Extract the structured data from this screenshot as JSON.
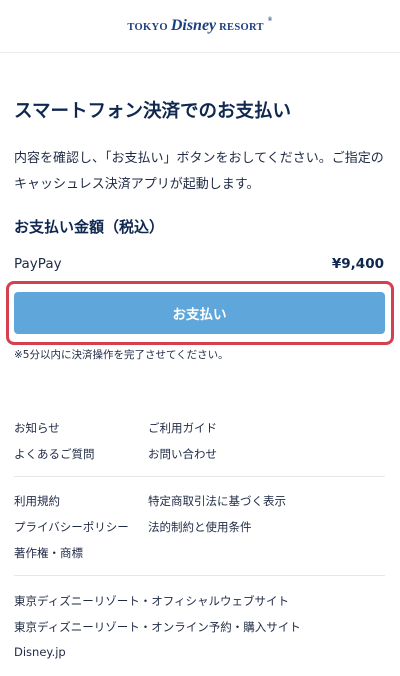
{
  "header": {
    "logo": {
      "part1": "TOKYO",
      "part2": "Disney",
      "part3": "RESORT",
      "reg": "®"
    }
  },
  "main": {
    "title": "スマートフォン決済でのお支払い",
    "description": "内容を確認し、「お支払い」ボタンをおしてください。ご指定のキャッシュレス決済アプリが起動します。",
    "amount_heading": "お支払い金額（税込）",
    "payment_method": "PayPay",
    "amount": "¥9,400",
    "pay_button_label": "お支払い",
    "note": "※5分以内に決済操作を完了させてください。"
  },
  "footer": {
    "group1": {
      "left": [
        "お知らせ",
        "よくあるご質問"
      ],
      "right": [
        "ご利用ガイド",
        "お問い合わせ"
      ]
    },
    "group2": {
      "left": [
        "利用規約",
        "プライバシーポリシー",
        "著作権・商標"
      ],
      "right": [
        "特定商取引法に基づく表示",
        "法的制約と使用条件"
      ]
    },
    "group3": [
      "東京ディズニーリゾート・オフィシャルウェブサイト",
      "東京ディズニーリゾート・オンライン予約・購入サイト",
      "Disney.jp"
    ]
  },
  "colors": {
    "accent_button": "#5fa7db",
    "highlight_border": "#d5404f",
    "heading_navy": "#0f2850",
    "logo_blue": "#1c3f80"
  }
}
